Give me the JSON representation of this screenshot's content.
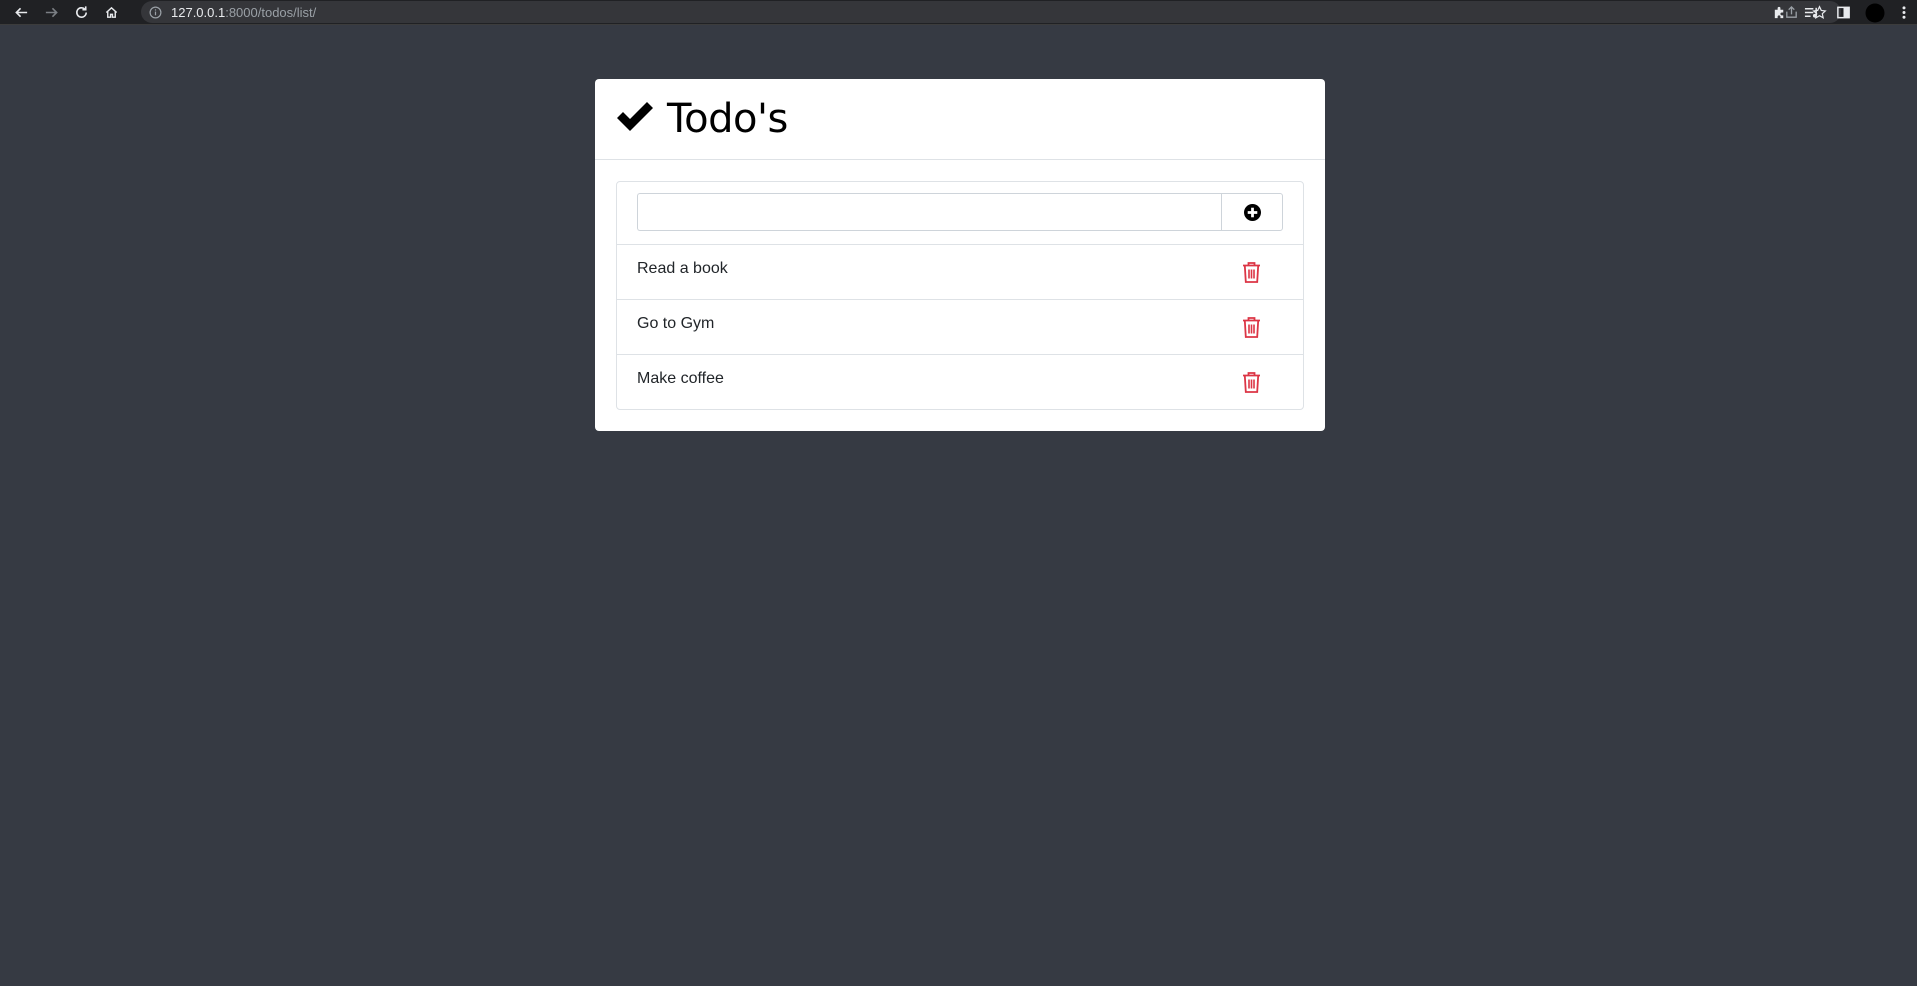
{
  "browser": {
    "url_host": "127.0.0.1",
    "url_rest": ":8000/todos/list/"
  },
  "card": {
    "title": "Todo's",
    "input_value": ""
  },
  "todos": [
    {
      "text": "Read a book"
    },
    {
      "text": "Go to Gym"
    },
    {
      "text": "Make coffee"
    }
  ],
  "colors": {
    "page_bg": "#363a43",
    "delete": "#dc3545"
  },
  "icons": {
    "title": "check-icon",
    "add": "plus-circle-icon",
    "delete": "trash-icon"
  }
}
